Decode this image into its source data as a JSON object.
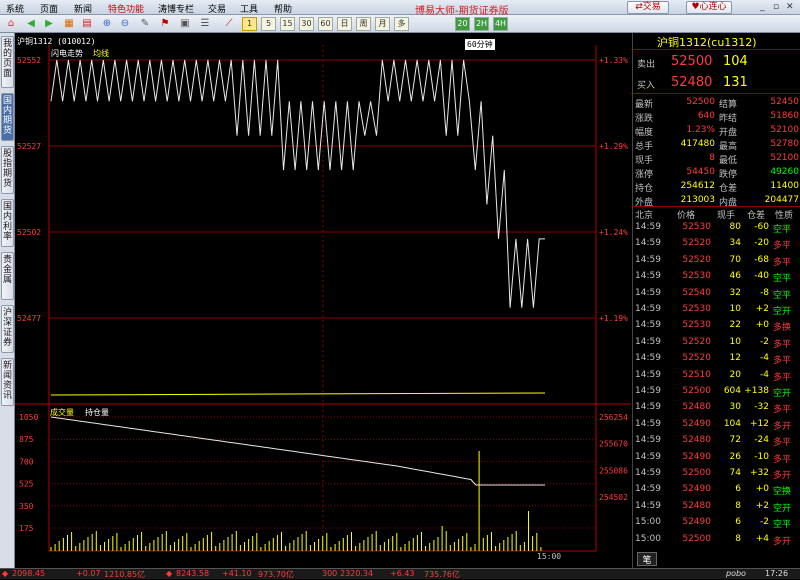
{
  "menubar": {
    "items": [
      "系统",
      "页面",
      "新闻",
      "特色功能",
      "涛博专栏",
      "交易",
      "工具",
      "帮助"
    ],
    "title": "博易大师-期货证券版",
    "trade_btn": "交易",
    "connect_btn": "心连心"
  },
  "toolbar": {
    "period_buttons": [
      "1",
      "5",
      "15",
      "30",
      "60",
      "日",
      "周",
      "月",
      "多",
      "20",
      "2H",
      "4H"
    ]
  },
  "sidebar": {
    "tabs": [
      "我的页面",
      "国内期货",
      "股指期货",
      "国内利率",
      "贵金属",
      "沪深证券",
      "新闻资讯"
    ]
  },
  "chart": {
    "contract": "沪铜1312 (010012)",
    "legend_price": "闪电走势",
    "legend_avg": "均线",
    "period_tip": "60分钟",
    "y_ticks": [
      "52552",
      "52527",
      "52502",
      "52477"
    ],
    "pct_ticks": [
      "+1.33%",
      "+1.29%",
      "+1.24%",
      "+1.19%"
    ],
    "legend_volume": "成交量",
    "legend_oi": "持仓量",
    "vol_ticks": [
      "1050",
      "875",
      "700",
      "525",
      "350",
      "175"
    ],
    "oi_ticks": [
      "256254",
      "255670",
      "255086",
      "254502"
    ],
    "time_label": "15:00"
  },
  "chart_data": [
    {
      "type": "line",
      "title": "闪电走势",
      "ylim": [
        52468,
        52555
      ],
      "series": [
        {
          "name": "闪电走势",
          "values": [
            52540,
            52552,
            52540,
            52552,
            52540,
            52552,
            52540,
            52552,
            52540,
            52552,
            52540,
            52552,
            52540,
            52552,
            52540,
            52552,
            52540,
            52552,
            52540,
            52552,
            52540,
            52552,
            52540,
            52552,
            52540,
            52552,
            52540,
            52552,
            52540,
            52552,
            52540,
            52552,
            52530,
            52552,
            52530,
            52552,
            52530,
            52552,
            52530,
            52552,
            52520,
            52540,
            52520,
            52540,
            52520,
            52540,
            52520,
            52540,
            52520,
            52540,
            52520,
            52540,
            52520,
            52540,
            52530,
            52540,
            52530,
            52552,
            52540,
            52552,
            52540,
            52552,
            52540,
            52552,
            52540,
            52552,
            52540,
            52552,
            52530,
            52552,
            52530,
            52552,
            52540,
            52520,
            52540,
            52510,
            52530,
            52500,
            52520,
            52480,
            52500,
            52480,
            52500,
            52480,
            52500,
            52500
          ]
        }
      ],
      "ylabel": ""
    },
    {
      "type": "bar",
      "title": "成交量",
      "ylim": [
        0,
        1050
      ],
      "series": [
        {
          "name": "成交量",
          "values": [
            80,
            34,
            70,
            46,
            32,
            10,
            22,
            10,
            12,
            20,
            604,
            30,
            104,
            72,
            26,
            74,
            6,
            8,
            6,
            8
          ]
        },
        {
          "name": "持仓量",
          "values": [
            256254,
            255670,
            255086,
            254502
          ]
        }
      ]
    }
  ],
  "quote": {
    "title": "沪铜1312(cu1312)",
    "sell_label": "卖出",
    "sell_price": "52500",
    "sell_vol": "104",
    "buy_label": "买入",
    "buy_price": "52480",
    "buy_vol": "131",
    "stats": [
      [
        "最新",
        "52500",
        "结算",
        "52450"
      ],
      [
        "涨跌",
        "640",
        "昨结",
        "51860"
      ],
      [
        "幅度",
        "1.23%",
        "开盘",
        "52100"
      ],
      [
        "总手",
        "417480",
        "最高",
        "52780"
      ],
      [
        "现手",
        "8",
        "最低",
        "52100"
      ],
      [
        "涨停",
        "54450",
        "跌停",
        "49260"
      ],
      [
        "持仓",
        "254612",
        "仓差",
        "11400"
      ],
      [
        "外盘",
        "213003",
        "内盘",
        "204477"
      ]
    ],
    "tick_header": [
      "北京",
      "价格",
      "现手",
      "仓差",
      "性质"
    ],
    "ticks": [
      [
        "14:59",
        "52530",
        "80",
        "-60",
        "空平"
      ],
      [
        "14:59",
        "52520",
        "34",
        "-20",
        "多平"
      ],
      [
        "14:59",
        "52520",
        "70",
        "-68",
        "多平"
      ],
      [
        "14:59",
        "52530",
        "46",
        "-40",
        "空平"
      ],
      [
        "14:59",
        "52540",
        "32",
        "-8",
        "空平"
      ],
      [
        "14:59",
        "52530",
        "10",
        "+2",
        "空开"
      ],
      [
        "14:59",
        "52530",
        "22",
        "+0",
        "多换"
      ],
      [
        "14:59",
        "52520",
        "10",
        "-2",
        "多平"
      ],
      [
        "14:59",
        "52520",
        "12",
        "-4",
        "多平"
      ],
      [
        "14:59",
        "52510",
        "20",
        "-4",
        "多平"
      ],
      [
        "14:59",
        "52500",
        "604",
        "+138",
        "空开"
      ],
      [
        "14:59",
        "52480",
        "30",
        "-32",
        "多平"
      ],
      [
        "14:59",
        "52490",
        "104",
        "+12",
        "多开"
      ],
      [
        "14:59",
        "52480",
        "72",
        "-24",
        "多平"
      ],
      [
        "14:59",
        "52490",
        "26",
        "-10",
        "多平"
      ],
      [
        "14:59",
        "52500",
        "74",
        "+32",
        "多开"
      ],
      [
        "14:59",
        "52490",
        "6",
        "+0",
        "空换"
      ],
      [
        "14:59",
        "52480",
        "8",
        "+2",
        "空开"
      ],
      [
        "15:00",
        "52490",
        "6",
        "-2",
        "空平"
      ],
      [
        "15:00",
        "52500",
        "8",
        "+4",
        "多开"
      ]
    ],
    "bottom_tab": "笔"
  },
  "status": {
    "items": [
      "2098.45",
      "+0.07",
      "1210.85亿",
      "8243.58",
      "+41.10",
      "973.70亿",
      "300",
      "2320.34",
      "+6.43",
      "735.76亿"
    ],
    "brand": "pobo",
    "time": "17:26"
  },
  "colors": {
    "up": "#ff3b3b",
    "down": "#00ff00",
    "yellow": "#ffff00",
    "grid": "#8b0000",
    "axis": "#b30000"
  }
}
